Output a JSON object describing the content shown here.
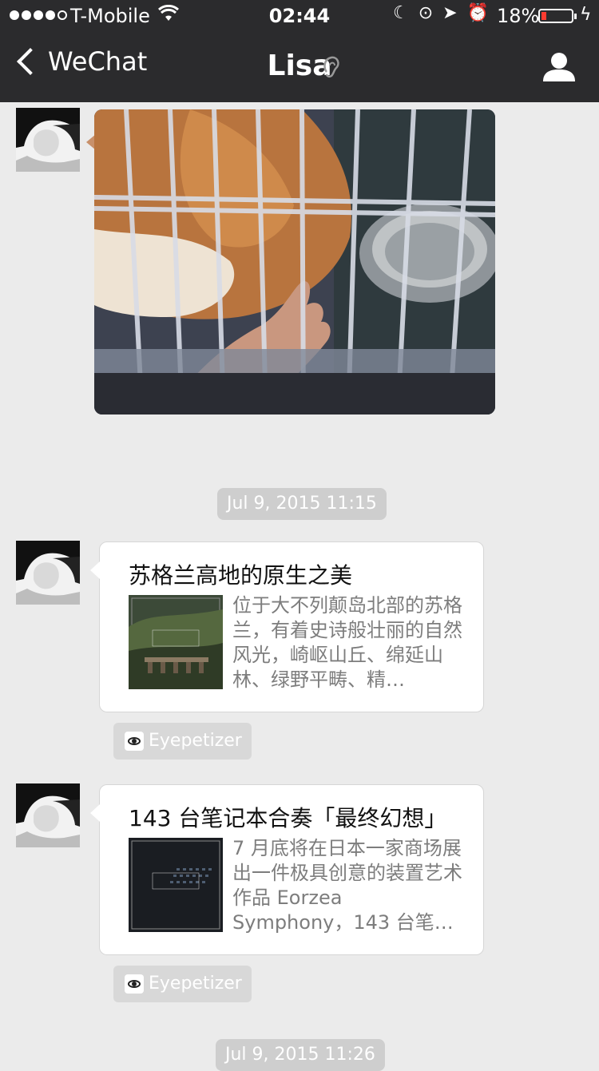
{
  "status_bar": {
    "carrier": "T-Mobile",
    "time": "02:44",
    "battery_percent": "18%",
    "battery_level": 0.18,
    "signal_bars": 4,
    "signal_total": 5
  },
  "nav": {
    "back_label": "WeChat",
    "title": "Lisa"
  },
  "messages": {
    "timestamps": [
      "Jul 9, 2015 11:15",
      "Jul 9, 2015 11:26"
    ],
    "cards": [
      {
        "title": "苏格兰高地的原生之美",
        "description": "位于大不列颠岛北部的苏格兰，有着史诗般壮丽的自然风光，崎岖山丘、绵延山林、绿野平畴、精…",
        "source": "Eyepetizer"
      },
      {
        "title": "143 台笔记本合奏「最终幻想」",
        "description": "7 月底将在日本一家商场展出一件极具创意的装置艺术作品 Eorzea Symphony，143 台笔…",
        "source": "Eyepetizer"
      }
    ]
  },
  "colors": {
    "nav_bg": "#2b2b2d",
    "chat_bg": "#ebebeb",
    "battery_low": "#ff3b30"
  }
}
